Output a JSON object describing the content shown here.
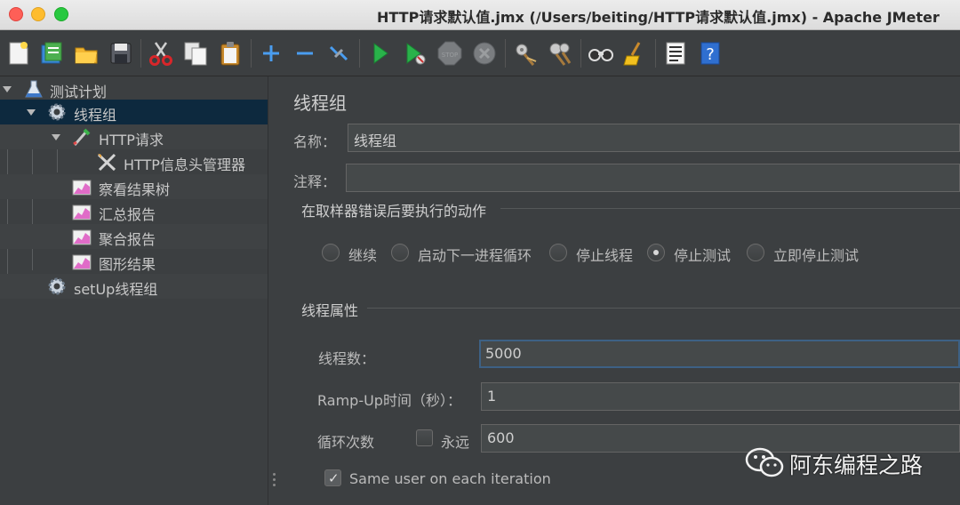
{
  "window": {
    "title": "HTTP请求默认值.jmx (/Users/beiting/HTTP请求默认值.jmx) - Apache JMeter"
  },
  "toolbar": {
    "buttons": [
      {
        "icon": "new-file-icon"
      },
      {
        "icon": "templates-icon"
      },
      {
        "icon": "open-folder-icon"
      },
      {
        "icon": "save-icon"
      },
      {
        "icon": "cut-icon"
      },
      {
        "icon": "copy-icon"
      },
      {
        "icon": "paste-icon"
      },
      {
        "icon": "expand-all-icon"
      },
      {
        "icon": "collapse-all-icon"
      },
      {
        "icon": "toggle-icon"
      },
      {
        "icon": "start-icon"
      },
      {
        "icon": "start-no-pause-icon"
      },
      {
        "icon": "stop-icon"
      },
      {
        "icon": "shutdown-icon"
      },
      {
        "icon": "clear-icon"
      },
      {
        "icon": "clear-all-icon"
      },
      {
        "icon": "search-icon"
      },
      {
        "icon": "reset-search-icon"
      },
      {
        "icon": "function-helper-icon"
      },
      {
        "icon": "help-icon"
      }
    ]
  },
  "tree": {
    "items": [
      {
        "label": "测试计划",
        "icon": "test-plan-icon",
        "expanded": true
      },
      {
        "label": "线程组",
        "icon": "thread-group-icon",
        "expanded": true,
        "selected": true
      },
      {
        "label": "HTTP请求",
        "icon": "http-sampler-icon",
        "expanded": true
      },
      {
        "label": "HTTP信息头管理器",
        "icon": "config-tools-icon"
      },
      {
        "label": "察看结果树",
        "icon": "listener-graph-icon"
      },
      {
        "label": "汇总报告",
        "icon": "listener-graph-icon"
      },
      {
        "label": "聚合报告",
        "icon": "listener-graph-icon"
      },
      {
        "label": "图形结果",
        "icon": "listener-graph-icon"
      },
      {
        "label": "setUp线程组",
        "icon": "thread-group-icon"
      }
    ]
  },
  "form": {
    "title": "线程组",
    "name_label": "名称：",
    "name_value": "线程组",
    "comment_label": "注释：",
    "comment_value": "",
    "error_action": {
      "title": "在取样器错误后要执行的动作",
      "options": [
        "继续",
        "启动下一进程循环",
        "停止线程",
        "停止测试",
        "立即停止测试"
      ],
      "selected": "停止测试"
    },
    "thread_props": {
      "title": "线程属性",
      "threads_label": "线程数：",
      "threads_value": "5000",
      "rampup_label": "Ramp-Up时间（秒）：",
      "rampup_value": "1",
      "loop_label": "循环次数",
      "forever_label": "永远",
      "forever_checked": false,
      "loop_value": "600",
      "same_user_label": "Same user on each iteration",
      "same_user_checked": true
    }
  },
  "watermark": {
    "text": "阿东编程之路",
    "icon": "wechat-icon"
  },
  "colors": {
    "background": "#3c3f41",
    "selection": "#0d293e",
    "focus_border": "#3d6185",
    "run_green": "#29b24a"
  }
}
